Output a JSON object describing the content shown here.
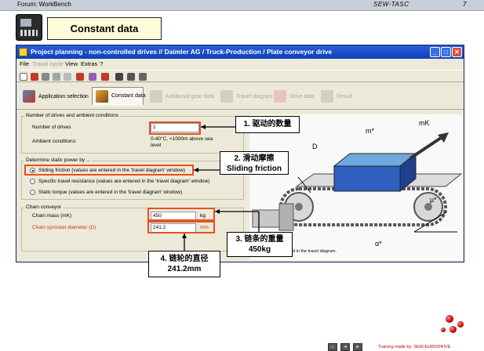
{
  "slide": {
    "forum": "Forum: WorkBench",
    "brand": "SEW-TASC",
    "page_no": "7",
    "title": "Constant data",
    "footer": "Training made by: SEW-EURODRIVE"
  },
  "window": {
    "title": "Project planning - non-controlled drives //      Daimler AG / Truck-Production / Plate conveyor drive",
    "menu": [
      "File",
      "Travel cycle",
      "View",
      "Extras",
      "?"
    ],
    "tabs": [
      "Application selection",
      "Constant data",
      "Additional gear data",
      "Travel diagram",
      "Drive data",
      "Result"
    ]
  },
  "form": {
    "group1_title": "Number of drives and ambient conditions",
    "drives_label": "Number of drives",
    "drives_value": "1",
    "ambient_label": "Ambient conditions:",
    "ambient_value_1": "0-40°C, <1000m above sea",
    "ambient_value_2": "level",
    "group2_title": "Determine static power by ...",
    "opt_sliding": "Sliding friction (values are entered in the 'travel diagram' window)",
    "opt_specific": "Specific travel resistance (values are entered in the 'travel diagram' window)",
    "opt_static": "Static torque (values are entered in the 'travel diagram' window)",
    "group3_title": "Chain conveyor",
    "chain_mass_label": "Chain mass (mK)",
    "chain_mass_value": "450",
    "chain_mass_unit": "kg",
    "sprocket_label": "Chain sprocket diameter (D)",
    "sprocket_value": "241.2",
    "sprocket_unit": "mm",
    "diagram_note": "are entered in the travel diagram."
  },
  "diagram_labels": {
    "m_load": "m*",
    "m_chain": "mK",
    "d": "D",
    "mu": "µ*",
    "alpha": "α*"
  },
  "callouts": {
    "c1": "1. 驱动的数量",
    "c2_line1": "2. 滑动摩擦",
    "c2_line2": "Sliding friction",
    "c3_line1": "3. 链条的重量",
    "c3_line2": "450kg",
    "c4_line1": "4. 链轮的直径",
    "c4_line2": "241.2mm"
  },
  "colors": {
    "highlight": "#e8521e",
    "titlebar": "#0b3fb8",
    "title_box": "#fcfcd8"
  }
}
